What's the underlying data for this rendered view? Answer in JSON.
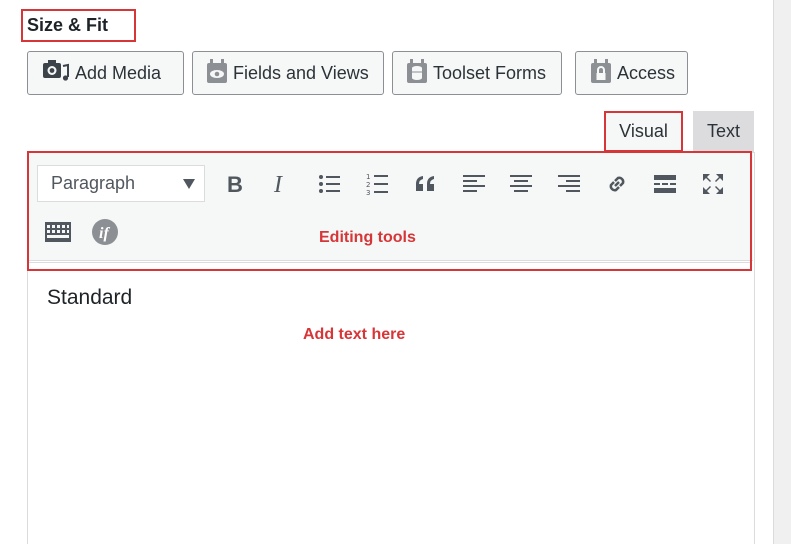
{
  "section": {
    "title": "Size & Fit"
  },
  "media_buttons": [
    {
      "label": "Add Media",
      "icon": "camera-music-icon"
    },
    {
      "label": "Fields and Views",
      "icon": "fields-views-icon"
    },
    {
      "label": "Toolset Forms",
      "icon": "toolset-forms-icon"
    },
    {
      "label": "Access",
      "icon": "lock-icon"
    }
  ],
  "tabs": {
    "visual": "Visual",
    "text": "Text"
  },
  "toolbar": {
    "format_value": "Paragraph",
    "buttons": [
      "bold-icon",
      "italic-icon",
      "bulleted-list-icon",
      "numbered-list-icon",
      "blockquote-icon",
      "align-left-icon",
      "align-center-icon",
      "align-right-icon",
      "link-icon",
      "read-more-icon",
      "fullscreen-icon",
      "toolbar-toggle-icon",
      "conditional-if-icon"
    ],
    "annotation": "Editing tools"
  },
  "content": {
    "text": "Standard",
    "annotation": "Add text here"
  },
  "colors": {
    "annotation": "#d63638",
    "toolbar_bg": "#f6f7f7",
    "icon": "#50575e"
  }
}
